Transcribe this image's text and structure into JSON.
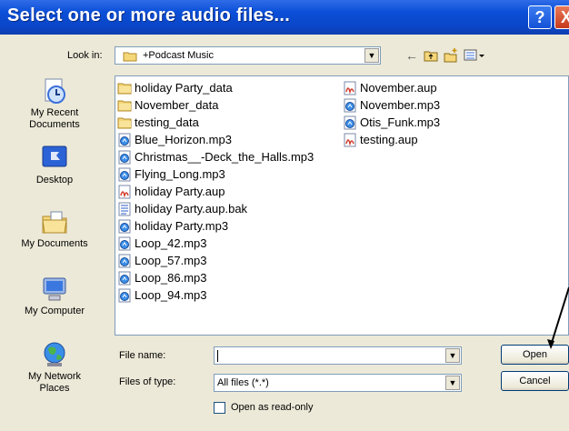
{
  "dialog": {
    "title": "Select one or more audio files...",
    "help_glyph": "?",
    "close_glyph": "X"
  },
  "lookin": {
    "label": "Look in:",
    "value": "+Podcast Music"
  },
  "places": [
    {
      "label_line1": "My Recent",
      "label_line2": "Documents",
      "icon": "recent-documents-icon"
    },
    {
      "label_line1": "Desktop",
      "label_line2": "",
      "icon": "desktop-icon"
    },
    {
      "label_line1": "My Documents",
      "label_line2": "",
      "icon": "my-documents-icon"
    },
    {
      "label_line1": "My Computer",
      "label_line2": "",
      "icon": "my-computer-icon"
    },
    {
      "label_line1": "My Network",
      "label_line2": "Places",
      "icon": "network-places-icon"
    }
  ],
  "files": {
    "column1": [
      {
        "name": "holiday Party_data",
        "type": "folder"
      },
      {
        "name": "November_data",
        "type": "folder"
      },
      {
        "name": "testing_data",
        "type": "folder"
      },
      {
        "name": "Blue_Horizon.mp3",
        "type": "mp3"
      },
      {
        "name": "Christmas__-Deck_the_Halls.mp3",
        "type": "mp3"
      },
      {
        "name": "Flying_Long.mp3",
        "type": "mp3"
      },
      {
        "name": "holiday Party.aup",
        "type": "aup"
      },
      {
        "name": "holiday Party.aup.bak",
        "type": "bak"
      },
      {
        "name": "holiday Party.mp3",
        "type": "mp3"
      },
      {
        "name": "Loop_42.mp3",
        "type": "mp3"
      },
      {
        "name": "Loop_57.mp3",
        "type": "mp3"
      },
      {
        "name": "Loop_86.mp3",
        "type": "mp3"
      },
      {
        "name": "Loop_94.mp3",
        "type": "mp3"
      }
    ],
    "column2": [
      {
        "name": "November.aup",
        "type": "aup"
      },
      {
        "name": "November.mp3",
        "type": "mp3"
      },
      {
        "name": "Otis_Funk.mp3",
        "type": "mp3"
      },
      {
        "name": "testing.aup",
        "type": "aup"
      }
    ]
  },
  "filename": {
    "label": "File name:",
    "value": ""
  },
  "filetype": {
    "label": "Files of type:",
    "value": "All files (*.*)"
  },
  "readonly": {
    "label": "Open as read-only",
    "checked": false
  },
  "buttons": {
    "open": "Open",
    "cancel": "Cancel"
  }
}
